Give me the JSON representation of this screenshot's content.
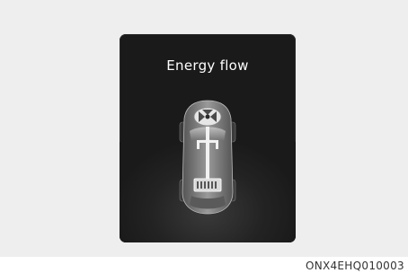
{
  "screen": {
    "title": "Energy flow"
  },
  "footer": {
    "code": "ONX4EHQ010003"
  },
  "colors": {
    "panel_background": "#eeeeee",
    "screen_background": "#1a1a1a",
    "title_text": "#ffffff"
  },
  "icons": {
    "vehicle": "car-topview-icon",
    "engine": "engine-icon",
    "battery": "battery-icon"
  }
}
